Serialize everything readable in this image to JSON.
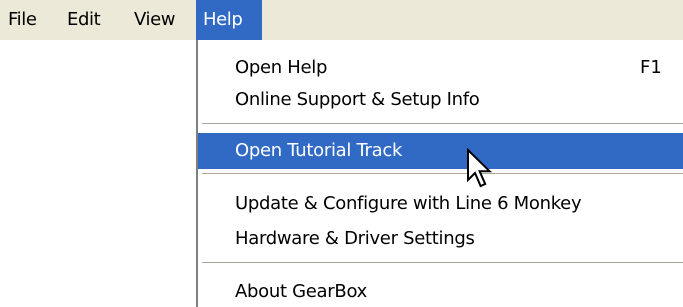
{
  "menubar": {
    "file_label": "File",
    "edit_label": "Edit",
    "view_label": "View",
    "help_label": "Help"
  },
  "help_menu": {
    "items": [
      {
        "label": "Open Help",
        "shortcut": "F1"
      },
      {
        "label": "Online Support & Setup Info"
      },
      {
        "label": "Open Tutorial Track"
      },
      {
        "label": "Update & Configure with Line 6 Monkey"
      },
      {
        "label": "Hardware & Driver Settings"
      },
      {
        "label": "About GearBox"
      }
    ],
    "highlighted_item": "Open Tutorial Track"
  },
  "colors": {
    "menubar_bg": "#ece9d8",
    "highlight_bg": "#316ac5",
    "highlight_text": "#ffffff",
    "separator": "#aca899"
  },
  "icons": {
    "cursor": "mouse-pointer-icon"
  }
}
